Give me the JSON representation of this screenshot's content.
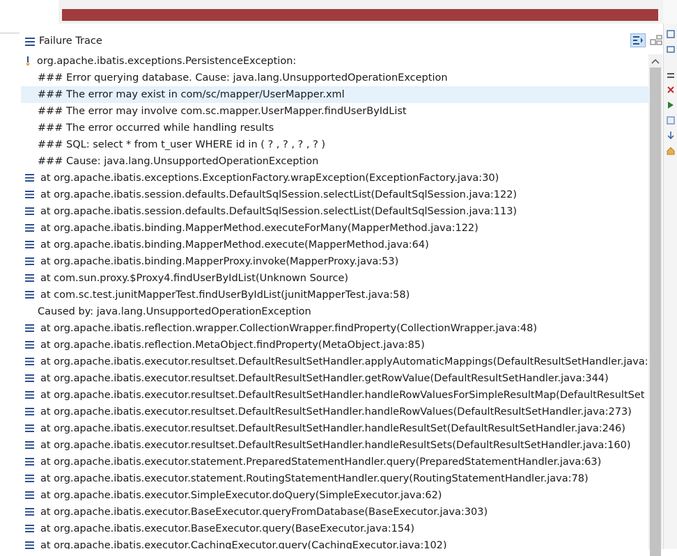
{
  "panel": {
    "title": "Failure Trace",
    "icon": "stack-trace-icon"
  },
  "toolbar": {
    "filter_icon": "filter-stack-icon",
    "compare_icon": "compare-results-icon"
  },
  "trace": [
    {
      "kind": "exception",
      "text": "org.apache.ibatis.exceptions.PersistenceException:"
    },
    {
      "kind": "message",
      "text": "### Error querying database.  Cause: java.lang.UnsupportedOperationException"
    },
    {
      "kind": "message",
      "text": "### The error may exist in com/sc/mapper/UserMapper.xml",
      "selected": true
    },
    {
      "kind": "message",
      "text": "### The error may involve com.sc.mapper.UserMapper.findUserByIdList"
    },
    {
      "kind": "message",
      "text": "### The error occurred while handling results"
    },
    {
      "kind": "message",
      "text": "### SQL: select * from t_user       WHERE id in      (      ?     ,      ?     ,      ?     ,      ?     )"
    },
    {
      "kind": "message",
      "text": "### Cause: java.lang.UnsupportedOperationException"
    },
    {
      "kind": "frame",
      "text": "at org.apache.ibatis.exceptions.ExceptionFactory.wrapException(ExceptionFactory.java:30)"
    },
    {
      "kind": "frame",
      "text": "at org.apache.ibatis.session.defaults.DefaultSqlSession.selectList(DefaultSqlSession.java:122)"
    },
    {
      "kind": "frame",
      "text": "at org.apache.ibatis.session.defaults.DefaultSqlSession.selectList(DefaultSqlSession.java:113)"
    },
    {
      "kind": "frame",
      "text": "at org.apache.ibatis.binding.MapperMethod.executeForMany(MapperMethod.java:122)"
    },
    {
      "kind": "frame",
      "text": "at org.apache.ibatis.binding.MapperMethod.execute(MapperMethod.java:64)"
    },
    {
      "kind": "frame",
      "text": "at org.apache.ibatis.binding.MapperProxy.invoke(MapperProxy.java:53)"
    },
    {
      "kind": "frame",
      "text": "at com.sun.proxy.$Proxy4.findUserByIdList(Unknown Source)"
    },
    {
      "kind": "frame",
      "text": "at com.sc.test.junitMapperTest.findUserByIdList(junitMapperTest.java:58)"
    },
    {
      "kind": "cause",
      "text": "Caused by: java.lang.UnsupportedOperationException"
    },
    {
      "kind": "frame",
      "text": "at org.apache.ibatis.reflection.wrapper.CollectionWrapper.findProperty(CollectionWrapper.java:48)"
    },
    {
      "kind": "frame",
      "text": "at org.apache.ibatis.reflection.MetaObject.findProperty(MetaObject.java:85)"
    },
    {
      "kind": "frame",
      "text": "at org.apache.ibatis.executor.resultset.DefaultResultSetHandler.applyAutomaticMappings(DefaultResultSetHandler.java:"
    },
    {
      "kind": "frame",
      "text": "at org.apache.ibatis.executor.resultset.DefaultResultSetHandler.getRowValue(DefaultResultSetHandler.java:344)"
    },
    {
      "kind": "frame",
      "text": "at org.apache.ibatis.executor.resultset.DefaultResultSetHandler.handleRowValuesForSimpleResultMap(DefaultResultSet"
    },
    {
      "kind": "frame",
      "text": "at org.apache.ibatis.executor.resultset.DefaultResultSetHandler.handleRowValues(DefaultResultSetHandler.java:273)"
    },
    {
      "kind": "frame",
      "text": "at org.apache.ibatis.executor.resultset.DefaultResultSetHandler.handleResultSet(DefaultResultSetHandler.java:246)"
    },
    {
      "kind": "frame",
      "text": "at org.apache.ibatis.executor.resultset.DefaultResultSetHandler.handleResultSets(DefaultResultSetHandler.java:160)"
    },
    {
      "kind": "frame",
      "text": "at org.apache.ibatis.executor.statement.PreparedStatementHandler.query(PreparedStatementHandler.java:63)"
    },
    {
      "kind": "frame",
      "text": "at org.apache.ibatis.executor.statement.RoutingStatementHandler.query(RoutingStatementHandler.java:78)"
    },
    {
      "kind": "frame",
      "text": "at org.apache.ibatis.executor.SimpleExecutor.doQuery(SimpleExecutor.java:62)"
    },
    {
      "kind": "frame",
      "text": "at org.apache.ibatis.executor.BaseExecutor.queryFromDatabase(BaseExecutor.java:303)"
    },
    {
      "kind": "frame",
      "text": "at org.apache.ibatis.executor.BaseExecutor.query(BaseExecutor.java:154)"
    },
    {
      "kind": "frame",
      "text": "at org.apache.ibatis.executor.CachingExecutor.query(CachingExecutor.java:102)"
    }
  ],
  "colors": {
    "progress_bar": "#a03c3c",
    "selection": "#e5f1fb",
    "frame_icon": "#2a4f8f"
  }
}
